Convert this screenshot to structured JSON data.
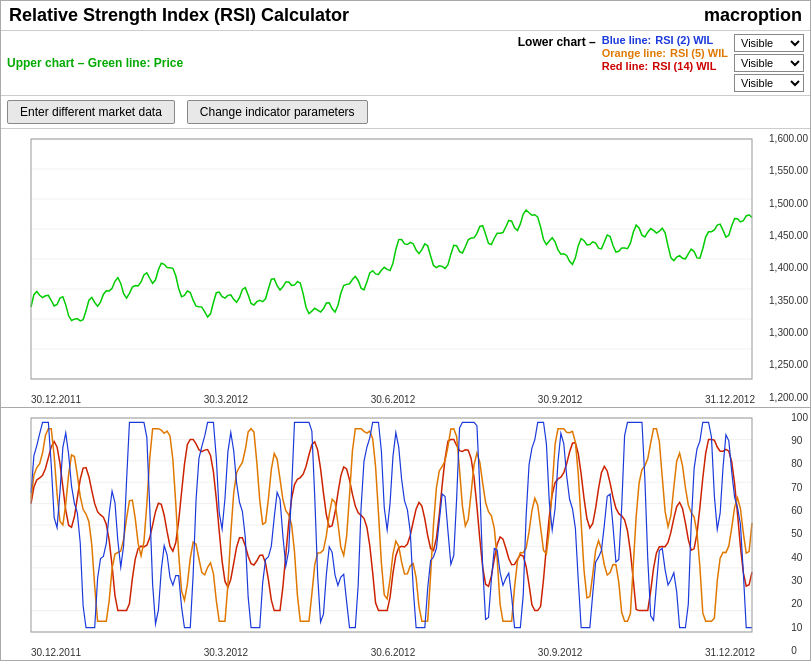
{
  "header": {
    "title": "Relative Strength Index (RSI) Calculator",
    "logo": "macroption"
  },
  "upper_chart": {
    "label": "Upper chart – Green line: Price"
  },
  "lower_chart": {
    "label": "Lower chart –",
    "blue_line_label": "Blue line:",
    "blue_line_value": "RSI (2) WIL",
    "orange_line_label": "Orange line:",
    "orange_line_value": "RSI (5) WIL",
    "red_line_label": "Red line:",
    "red_line_value": "RSI (14) WIL"
  },
  "dropdowns": {
    "blue_visible": "Visible",
    "orange_visible": "Visible",
    "red_visible": "Visible"
  },
  "buttons": {
    "enter_data": "Enter different market data",
    "change_params": "Change indicator parameters"
  },
  "upper_y_axis": [
    "1,600.00",
    "1,550.00",
    "1,500.00",
    "1,450.00",
    "1,400.00",
    "1,350.00",
    "1,300.00",
    "1,250.00",
    "1,200.00"
  ],
  "lower_y_axis": [
    "100",
    "90",
    "80",
    "70",
    "60",
    "50",
    "40",
    "30",
    "20",
    "10",
    "0"
  ],
  "x_axis_upper": [
    "30.12.2011",
    "30.3.2012",
    "30.6.2012",
    "30.9.2012",
    "31.12.2012"
  ],
  "x_axis_lower": [
    "30.12.2011",
    "30.3.2012",
    "30.6.2012",
    "30.9.2012",
    "31.12.2012"
  ]
}
